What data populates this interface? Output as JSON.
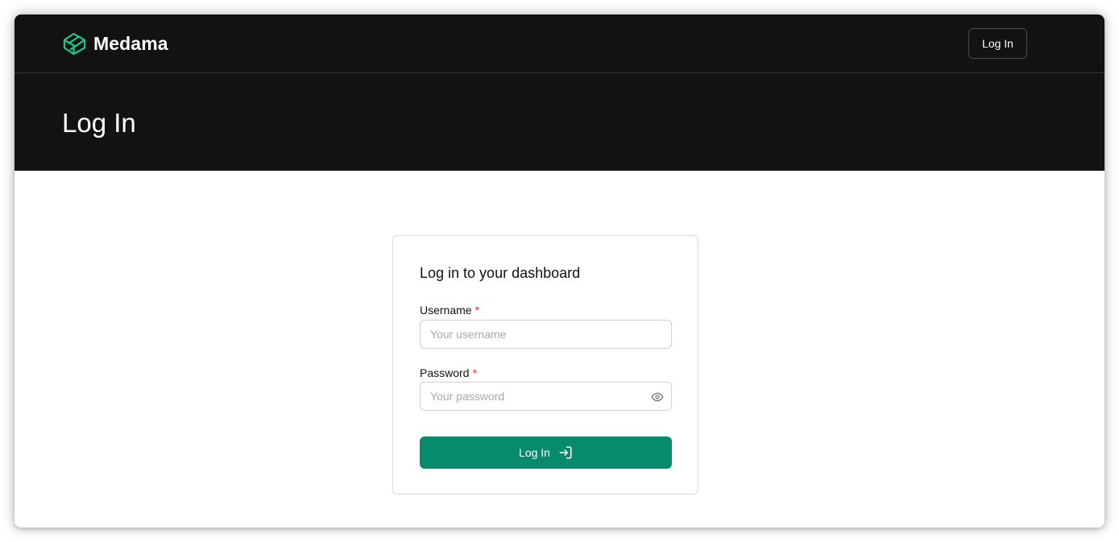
{
  "header": {
    "brand_name": "Medama",
    "brand_icon": "medama-logo-icon",
    "login_button": "Log In"
  },
  "hero": {
    "title": "Log In"
  },
  "form": {
    "title": "Log in to your dashboard",
    "username": {
      "label": "Username",
      "required_marker": "*",
      "placeholder": "Your username",
      "value": ""
    },
    "password": {
      "label": "Password",
      "required_marker": "*",
      "placeholder": "Your password",
      "value": "",
      "toggle_icon": "eye-icon"
    },
    "submit_label": "Log In",
    "submit_icon": "login-arrow-icon"
  },
  "colors": {
    "header_bg": "#121212",
    "brand_accent": "#1bc98e",
    "primary_button": "#088a6c",
    "required": "#e03131"
  }
}
